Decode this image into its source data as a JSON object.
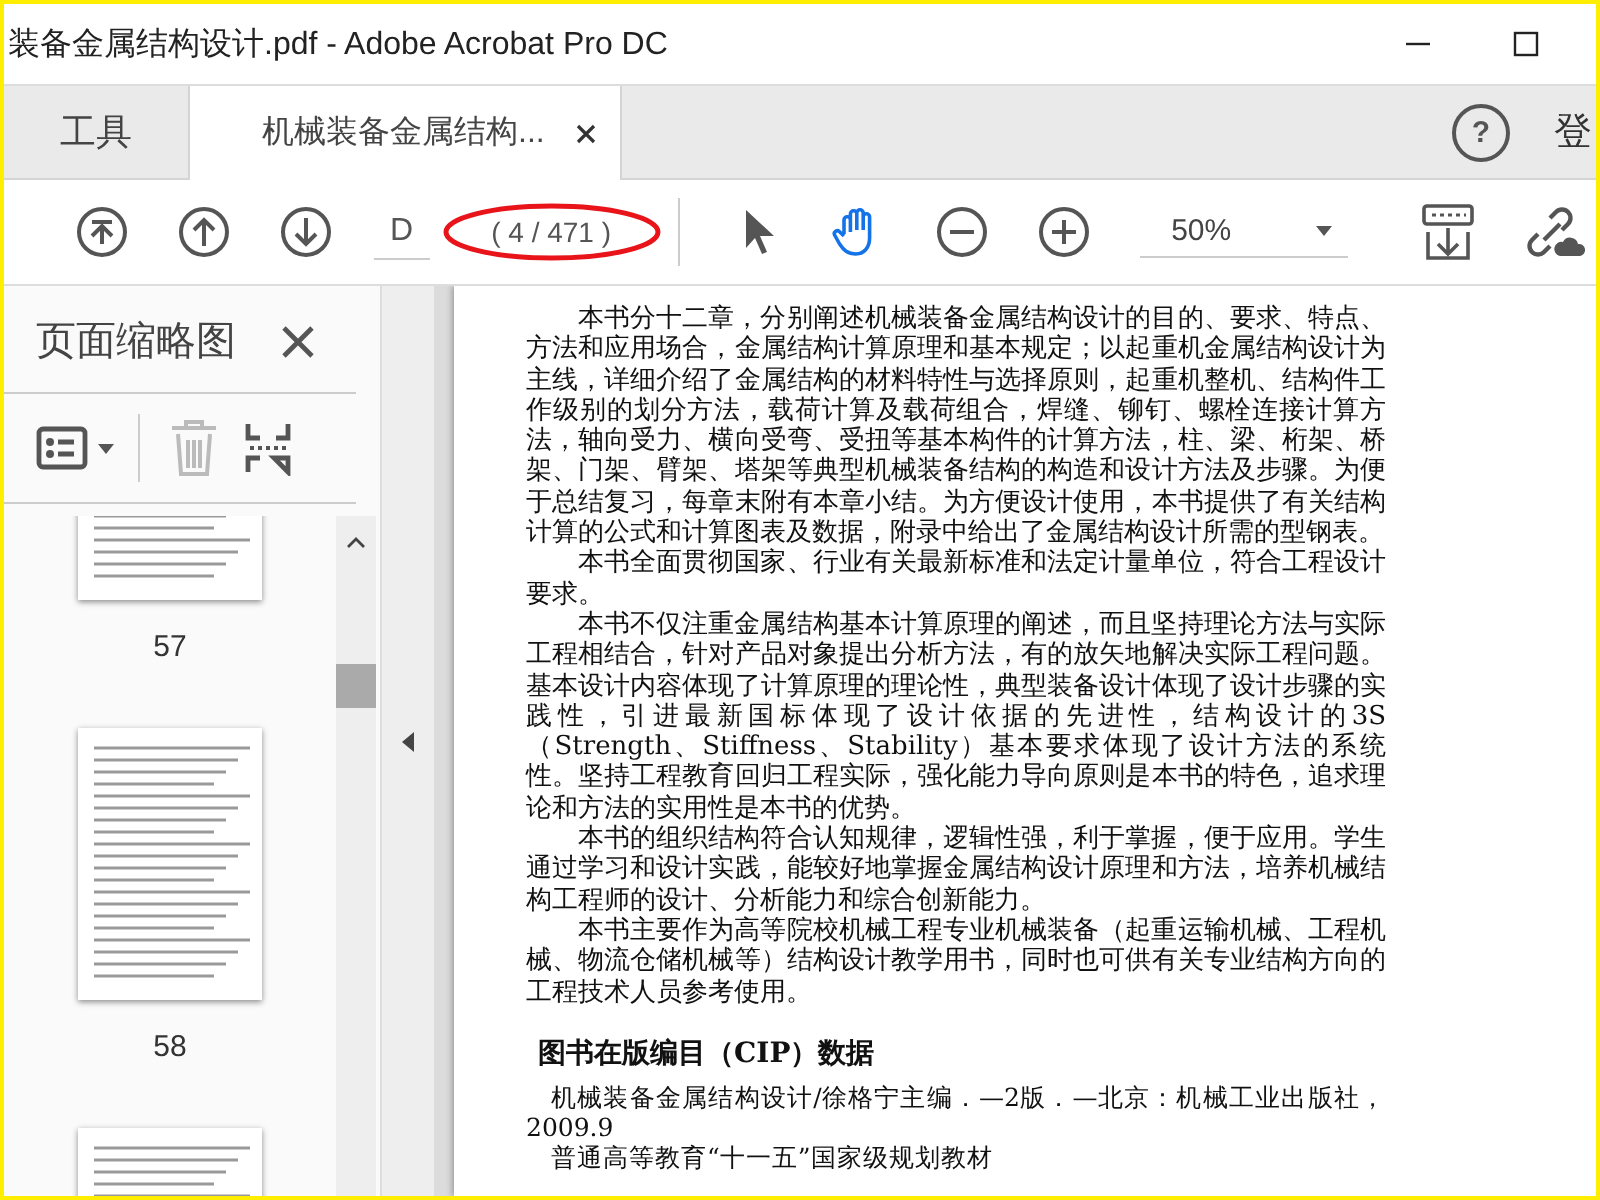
{
  "window": {
    "title": "装备金属结构设计.pdf - Adobe Acrobat Pro DC"
  },
  "tabs": [
    {
      "label": "工具",
      "selected": false
    },
    {
      "label": "机械装备金属结构...",
      "selected": true
    }
  ],
  "help_label": "?",
  "account_label": "登",
  "toolbar": {
    "page_field": "D",
    "page_count": "( 4 / 471 )",
    "zoom": "50%",
    "tools": [
      {
        "kind": "select",
        "selected": false
      },
      {
        "kind": "hand",
        "selected": true
      }
    ]
  },
  "sidebar": {
    "title": "页面缩略图",
    "thumbnail_labels": [
      "57",
      "58"
    ]
  },
  "document": {
    "paragraphs": [
      "本书分十二章，分别阐述机械装备金属结构设计的目的、要求、特点、方法和应用场合，金属结构计算原理和基本规定；以起重机金属结构设计为主线，详细介绍了金属结构的材料特性与选择原则，起重机整机、结构件工作级别的划分方法，载荷计算及载荷组合，焊缝、铆钉、螺栓连接计算方法，轴向受力、横向受弯、受扭等基本构件的计算方法，柱、梁、桁架、桥架、门架、臂架、塔架等典型机械装备结构的构造和设计方法及步骤。为便于总结复习，每章末附有本章小结。为方便设计使用，本书提供了有关结构计算的公式和计算图表及数据，附录中给出了金属结构设计所需的型钢表。",
      "本书全面贯彻国家、行业有关最新标准和法定计量单位，符合工程设计要求。",
      "本书不仅注重金属结构基本计算原理的阐述，而且坚持理论方法与实际工程相结合，针对产品对象提出分析方法，有的放矢地解决实际工程问题。基本设计内容体现了计算原理的理论性，典型装备设计体现了设计步骤的实践性，引进最新国标体现了设计依据的先进性，结构设计的3S（Strength、Stiffness、Stability）基本要求体现了设计方法的系统性。坚持工程教育回归工程实际，强化能力导向原则是本书的特色，追求理论和方法的实用性是本书的优势。",
      "本书的组织结构符合认知规律，逻辑性强，利于掌握，便于应用。学生通过学习和设计实践，能较好地掌握金属结构设计原理和方法，培养机械结构工程师的设计、分析能力和综合创新能力。",
      "本书主要作为高等院校机械工程专业机械装备（起重运输机械、工程机械、物流仓储机械等）结构设计教学用书，同时也可供有关专业结构方向的工程技术人员参考使用。"
    ],
    "heading": "图书在版编目（CIP）数据",
    "cip_lines": [
      "机械装备金属结构设计/徐格宁主编．—2版．—北京：机械工业出版社，2009.9",
      "普通高等教育“十一五”国家级规划教材"
    ]
  }
}
